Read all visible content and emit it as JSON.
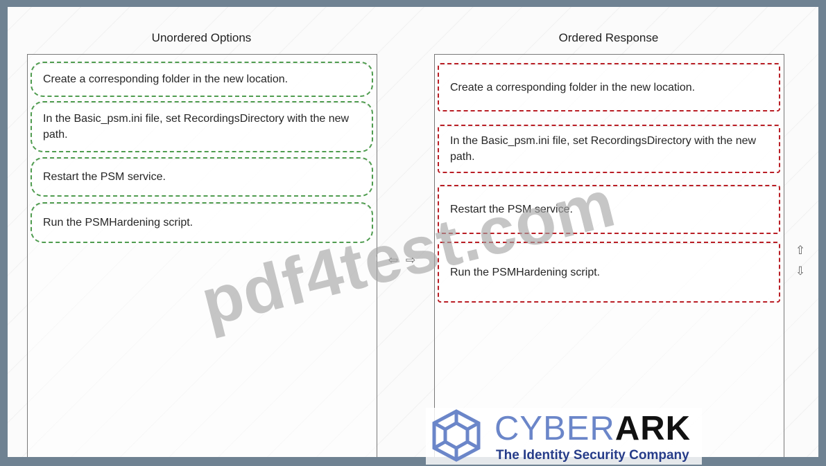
{
  "titles": {
    "left": "Unordered Options",
    "right": "Ordered Response"
  },
  "left_items": [
    "Create a corresponding folder in the new location.",
    "In the Basic_psm.ini file, set RecordingsDirectory with the new path.",
    "Restart the PSM service.",
    "Run the PSMHardening script."
  ],
  "right_items": [
    "Create a corresponding folder in the new location.",
    "In the Basic_psm.ini file, set RecordingsDirectory with the new path.",
    "Restart the PSM service.",
    "Run the PSMHardening script."
  ],
  "controls": {
    "move_left_icon": "⇦",
    "move_right_icon": "⇨",
    "move_up_icon": "⇧",
    "move_down_icon": "⇩"
  },
  "watermark": "pdf4test.com",
  "logo": {
    "brand_light": "CYBER",
    "brand_bold": "ARK",
    "tagline": "The Identity Security Company"
  },
  "colors": {
    "green_dash": "#4f9c4f",
    "red_dash": "#b91d24",
    "logo_blue": "#6b86c9"
  }
}
